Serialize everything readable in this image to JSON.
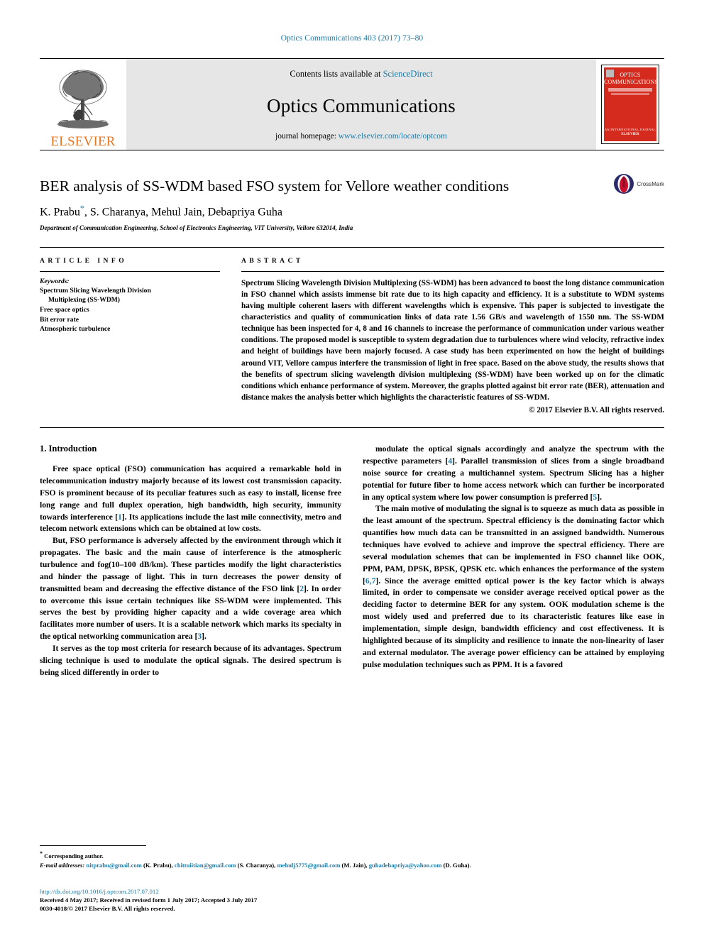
{
  "running_head": "Optics Communications 403 (2017) 73–80",
  "banner": {
    "publisher_name": "ELSEVIER",
    "contents_prefix": "Contents lists available at ",
    "contents_link": "ScienceDirect",
    "journal_title": "Optics Communications",
    "homepage_prefix": "journal homepage: ",
    "homepage_url": "www.elsevier.com/locate/optcom",
    "cover": {
      "line1": "OPTICS",
      "line2": "COMMUNICATIONS",
      "bottom1": "AN INTERNATIONAL JOURNAL",
      "bottom2": "ELSEVIER"
    }
  },
  "article": {
    "title": "BER analysis of SS-WDM based FSO system for Vellore weather conditions",
    "authors": "K. Prabu",
    "corresponding_marker": "*",
    "authors_rest": ", S. Charanya, Mehul Jain, Debapriya Guha",
    "affiliation": "Department of Communication Engineering, School of Electronics Engineering, VIT University, Vellore 632014, India",
    "crossmark_label": "CrossMark"
  },
  "info": {
    "heading": "ARTICLE INFO",
    "keywords_label": "Keywords:",
    "keywords": [
      {
        "text": "Spectrum Slicing Wavelength Division",
        "indent": false
      },
      {
        "text": "Multiplexing (SS-WDM)",
        "indent": true
      },
      {
        "text": "Free space optics",
        "indent": false
      },
      {
        "text": "Bit error rate",
        "indent": false
      },
      {
        "text": "Atmospheric turbulence",
        "indent": false
      }
    ]
  },
  "abstract": {
    "heading": "ABSTRACT",
    "text": "Spectrum Slicing Wavelength Division Multiplexing (SS-WDM) has been advanced to boost the long distance communication in FSO channel which assists immense bit rate due to its high capacity and efficiency. It is a substitute to WDM systems having multiple coherent lasers with different wavelengths which is expensive. This paper is subjected to investigate the characteristics and quality of communication links of data rate 1.56 GB/s and wavelength of 1550 nm. The SS-WDM technique has been inspected for 4, 8 and 16 channels to increase the performance of communication under various weather conditions. The proposed model is susceptible to system degradation due to turbulences where wind velocity, refractive index and height of buildings have been majorly focused. A case study has been experimented on how the height of buildings around VIT, Vellore campus interfere the transmission of light in free space. Based on the above study, the results shows that the benefits of spectrum slicing wavelength division multiplexing (SS-WDM) have been worked up on for the climatic conditions which enhance performance of system. Moreover, the graphs plotted against bit error rate (BER), attenuation and distance makes the analysis better which highlights the characteristic features of SS-WDM.",
    "copyright": "© 2017 Elsevier B.V. All rights reserved."
  },
  "body": {
    "section_title": "1. Introduction",
    "left_paragraphs": [
      {
        "parts": [
          {
            "t": "Free space optical (FSO) communication has acquired a remarkable hold in telecommunication industry majorly because of its lowest cost transmission capacity. FSO is prominent because of its peculiar features such as easy to install, license free long range and full duplex operation, high bandwidth, high security, immunity towards interference [",
            "cite": false
          },
          {
            "t": "1",
            "cite": true
          },
          {
            "t": "]. Its applications include the last mile connectivity, metro and telecom network extensions which can be obtained at low costs.",
            "cite": false
          }
        ]
      },
      {
        "parts": [
          {
            "t": "But, FSO performance is adversely affected by the environment through which it propagates. The basic and the main cause of interference is the atmospheric turbulence and fog(10–100 dB/km). These particles modify the light characteristics and hinder the passage of light. This in turn decreases the power density of transmitted beam and decreasing the effective distance of the FSO link [",
            "cite": false
          },
          {
            "t": "2",
            "cite": true
          },
          {
            "t": "]. In order to overcome this issue certain techniques like SS-WDM were implemented. This serves the best by providing higher capacity and a wide coverage area which facilitates more number of users. It is a scalable network which marks its specialty in the optical networking communication area [",
            "cite": false
          },
          {
            "t": "3",
            "cite": true
          },
          {
            "t": "].",
            "cite": false
          }
        ]
      },
      {
        "parts": [
          {
            "t": "It serves as the top most criteria for research because of its advantages. Spectrum slicing technique is used to modulate the optical signals. The desired spectrum is being sliced differently in order to",
            "cite": false
          }
        ]
      }
    ],
    "right_paragraphs": [
      {
        "parts": [
          {
            "t": "modulate the optical signals accordingly and analyze the spectrum with the respective parameters [",
            "cite": false
          },
          {
            "t": "4",
            "cite": true
          },
          {
            "t": "]. Parallel transmission of slices from a single broadband noise source for creating a multichannel system. Spectrum Slicing has a higher potential for future fiber to home access network which can further be incorporated in any optical system where low power consumption is preferred [",
            "cite": false
          },
          {
            "t": "5",
            "cite": true
          },
          {
            "t": "].",
            "cite": false
          }
        ]
      },
      {
        "parts": [
          {
            "t": "The main motive of modulating the signal is to squeeze as much data as possible in the least amount of the spectrum. Spectral efficiency is the dominating factor which quantifies how much data can be transmitted in an assigned bandwidth. Numerous techniques have evolved to achieve and improve the spectral efficiency. There are several modulation schemes that can be implemented in FSO channel like OOK, PPM, PAM, DPSK, BPSK, QPSK etc. which enhances the performance of the system [",
            "cite": false
          },
          {
            "t": "6,7",
            "cite": true
          },
          {
            "t": "]. Since the average emitted optical power is the key factor which is always limited, in order to compensate we consider average received optical power as the deciding factor to determine BER for any system. OOK modulation scheme is the most widely used and preferred due to its characteristic features like ease in implementation, simple design, bandwidth efficiency and cost effectiveness. It is highlighted because of its simplicity and resilience to innate the non-linearity of laser and external modulator. The average power efficiency can be attained by employing pulse modulation techniques such as PPM. It is a favored",
            "cite": false
          }
        ]
      }
    ]
  },
  "footnote": {
    "corresponding": "Corresponding author.",
    "emails_label": "E-mail addresses:",
    "emails": [
      {
        "mail": "nitprabu@gmail.com",
        "who": " (K. Prabu), "
      },
      {
        "mail": "chittuiitian@gmail.com",
        "who": " (S. Charanya), "
      },
      {
        "mail": "mehulj5775@gmail.com",
        "who": " (M. Jain), "
      },
      {
        "mail": "guhadebapriya@yahoo.com",
        "who": " (D. Guha)."
      }
    ]
  },
  "footer": {
    "doi": "http://dx.doi.org/10.1016/j.optcom.2017.07.012",
    "dates": "Received 4 May 2017; Received in revised form 1 July 2017; Accepted 3 July 2017",
    "issn": "0030-4018/© 2017 Elsevier B.V. All rights reserved."
  },
  "colors": {
    "link": "#1a7ba8",
    "elsevier_orange": "#E87722",
    "cover_red": "#d52b1e"
  }
}
